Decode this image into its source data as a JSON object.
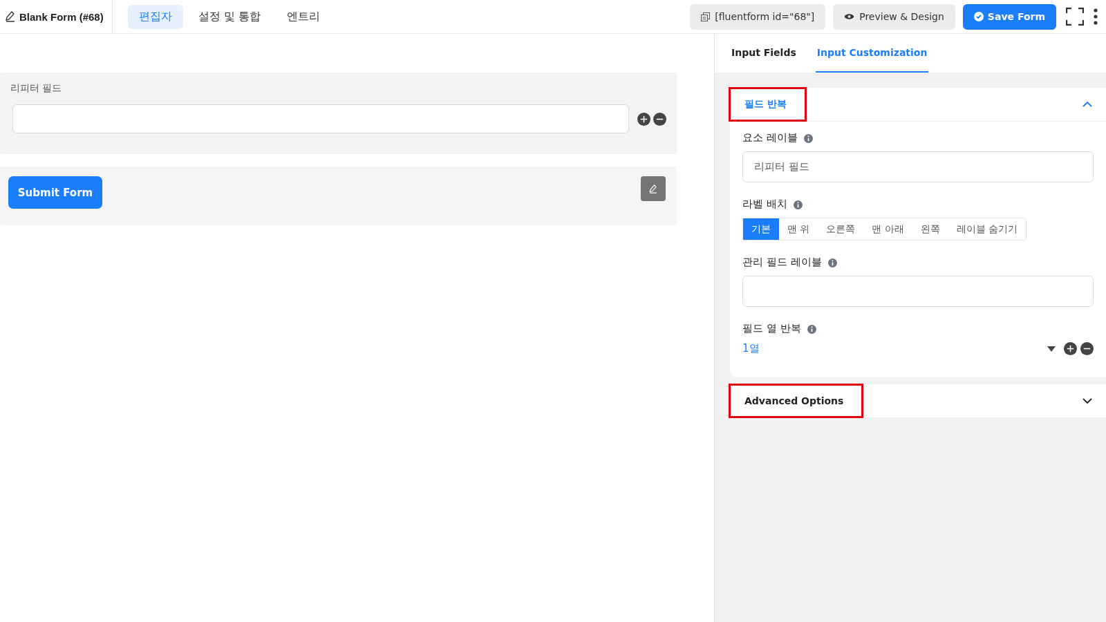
{
  "header": {
    "title": "Blank Form (#68)",
    "tabs": [
      {
        "label": "편집자",
        "selected": true
      },
      {
        "label": "설정 및 통합",
        "selected": false
      },
      {
        "label": "엔트리",
        "selected": false
      }
    ],
    "shortcode": "[fluentform id=\"68\"]",
    "preview": "Preview & Design",
    "save": "Save Form"
  },
  "form": {
    "repeater_label": "리피터 필드",
    "submit": "Submit Form"
  },
  "panel": {
    "tabs": [
      {
        "label": "Input Fields",
        "selected": false
      },
      {
        "label": "Input Customization",
        "selected": true
      }
    ],
    "sections": [
      {
        "title": "필드 반복",
        "expanded": true,
        "highlighted": true,
        "element_label": {
          "label": "요소 레이블",
          "value": "리피터 필드"
        },
        "label_placement": {
          "label": "라벨 배치",
          "options": [
            {
              "label": "기본",
              "selected": true
            },
            {
              "label": "맨 위",
              "selected": false
            },
            {
              "label": "오른쪽",
              "selected": false
            },
            {
              "label": "맨 아래",
              "selected": false
            },
            {
              "label": "왼쪽",
              "selected": false
            },
            {
              "label": "레이블 숨기기",
              "selected": false
            }
          ]
        },
        "admin_label": {
          "label": "관리 필드 레이블"
        },
        "repeat_columns": {
          "label": "필드 열 반복",
          "column": "1열"
        }
      },
      {
        "title": "Advanced Options",
        "expanded": false,
        "highlighted": true
      }
    ]
  }
}
